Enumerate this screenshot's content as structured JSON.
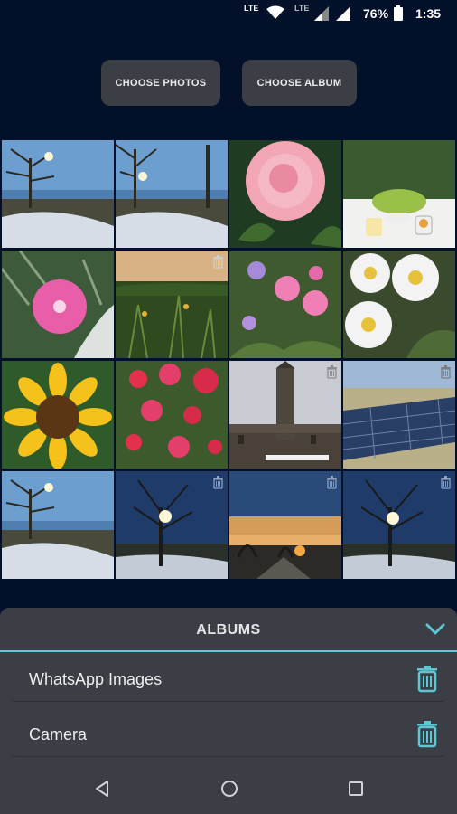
{
  "status_bar": {
    "lte_primary": "LTE",
    "lte_secondary": "LTE",
    "battery_percent": "76%",
    "time": "1:35",
    "icons": [
      "wifi-icon",
      "signal-icon",
      "signal-icon",
      "battery-icon"
    ]
  },
  "actions": {
    "choose_photos": "CHOOSE PHOTOS",
    "choose_album": "CHOOSE ALBUM"
  },
  "photo_grid": {
    "columns": 4,
    "rows": 4,
    "tiles": [
      {
        "subject": "winter-river-sunset",
        "trash_visible": false
      },
      {
        "subject": "winter-river-sunset",
        "trash_visible": false
      },
      {
        "subject": "pink-rose",
        "trash_visible": false
      },
      {
        "subject": "table-with-mugs-and-plants",
        "trash_visible": false
      },
      {
        "subject": "pink-flower",
        "trash_visible": false
      },
      {
        "subject": "sunset-meadow",
        "trash_visible": true
      },
      {
        "subject": "pink-and-purple-flowers",
        "trash_visible": false
      },
      {
        "subject": "white-anemones",
        "trash_visible": false
      },
      {
        "subject": "sunflower",
        "trash_visible": false
      },
      {
        "subject": "red-flowers",
        "trash_visible": false
      },
      {
        "subject": "city-hall-tower",
        "trash_visible": true
      },
      {
        "subject": "solar-farm",
        "trash_visible": true
      },
      {
        "subject": "winter-river-sunset",
        "trash_visible": false
      },
      {
        "subject": "tree-at-dusk",
        "trash_visible": true
      },
      {
        "subject": "sunset-horizon",
        "trash_visible": true
      },
      {
        "subject": "tree-at-dusk",
        "trash_visible": true
      }
    ]
  },
  "albums": {
    "title": "ALBUMS",
    "items": [
      {
        "label": "WhatsApp Images"
      },
      {
        "label": "Camera"
      }
    ]
  },
  "colors": {
    "background": "#021029",
    "panel": "#3b3f45",
    "accent": "#5fc6d3"
  },
  "nav": {
    "icons": [
      "back-icon",
      "home-icon",
      "recents-icon"
    ]
  }
}
